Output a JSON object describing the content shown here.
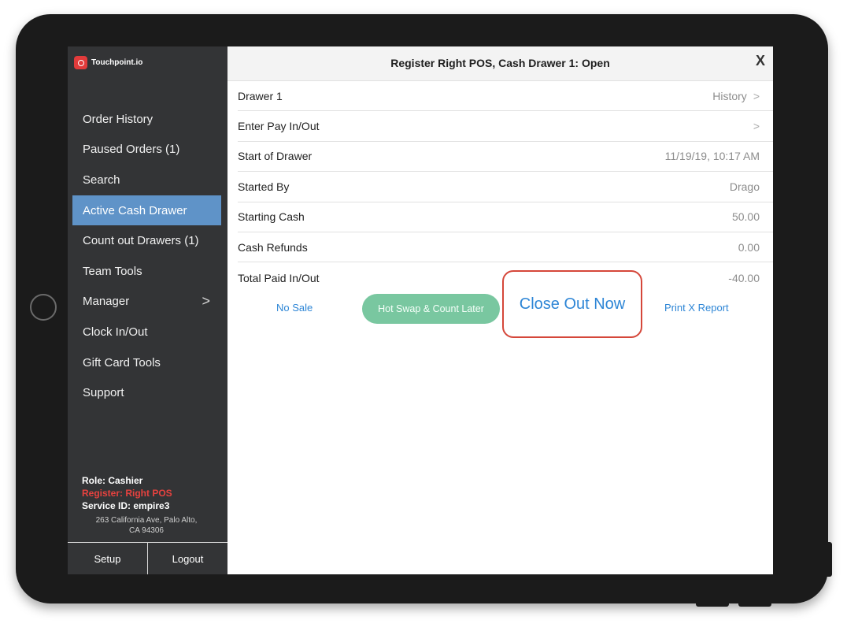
{
  "brand": {
    "name": "Touchpoint.io",
    "accent": "#e23b3b"
  },
  "sidebar": {
    "items": [
      {
        "label": "Order History"
      },
      {
        "label": "Paused Orders (1)"
      },
      {
        "label": "Search"
      },
      {
        "label": "Active Cash Drawer",
        "active": true
      },
      {
        "label": "Count out Drawers (1)"
      },
      {
        "label": "Team Tools"
      },
      {
        "label": "Manager",
        "chevron": ">"
      },
      {
        "label": "Clock In/Out"
      },
      {
        "label": "Gift Card Tools"
      },
      {
        "label": "Support"
      }
    ],
    "role": "Role: Cashier",
    "register": "Register: Right POS",
    "service_id": "Service ID: empire3",
    "address_line1": "263 California Ave, Palo Alto,",
    "address_line2": "CA 94306",
    "setup_label": "Setup",
    "logout_label": "Logout",
    "active_color": "#5f93c8"
  },
  "header": {
    "title": "Register Right POS, Cash Drawer 1: Open",
    "close_label": "X"
  },
  "rows": [
    {
      "label": "Drawer 1",
      "value": "History",
      "arrow": ">"
    },
    {
      "label": "Enter Pay In/Out",
      "value": "",
      "arrow": ">"
    },
    {
      "label": "Start of Drawer",
      "value": "11/19/19, 10:17 AM"
    },
    {
      "label": "Started By",
      "value": "Drago"
    },
    {
      "label": "Starting Cash",
      "value": "50.00"
    },
    {
      "label": "Cash Refunds",
      "value": "0.00"
    },
    {
      "label": "Total Paid In/Out",
      "value": "-40.00"
    }
  ],
  "actions": {
    "no_sale": "No Sale",
    "hot_swap": "Hot Swap & Count Later",
    "close_out": "Close Out Now",
    "print_x": "Print X Report",
    "link_color": "#2e86d6",
    "swap_color": "#79c7a0",
    "highlight_color": "#d5473a"
  }
}
